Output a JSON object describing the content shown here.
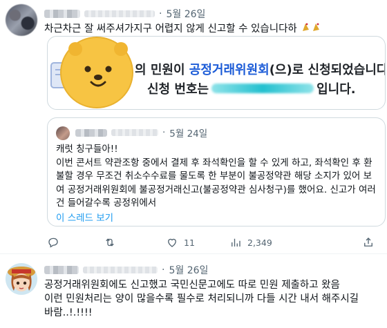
{
  "post1": {
    "dot": "·",
    "date": "5월 26일",
    "text": "차근차근 잘 써주셔가지구 어렵지 않게 신고할 수 있습니다하",
    "emoji_icon": "party-popper-icon",
    "image_card": {
      "line1_prefix": "의 민원이 ",
      "line1_accent": "공정거래위원회",
      "line1_suffix": "(으)로 신청되었습니다.",
      "line2_prefix": "신청 번호는",
      "line2_suffix": "입니다."
    },
    "quote": {
      "dot": "·",
      "date": "5월 24일",
      "lines": [
        "캐럿 칭구들아!!",
        "이번 콘서트 약관조항 중에서 결제 후 좌석확인을 할 수 있게 하고, 좌석확인 후 환불할 경우 무조건 취소수수료를 물도록 한 부분이 불공정약관 해당 소지가 있어 보여 공정거래위원회에 불공정거래신고(불공정약관 심사청구)를 했어요. 신고가 여러 건 들어갈수록 공정위에서"
      ],
      "show_thread": "이 스레드 보기"
    },
    "actions": {
      "reply_count": "",
      "retweet_count": "",
      "like_count": "11",
      "views_count": "2,349"
    }
  },
  "post2": {
    "dot": "·",
    "date": "5월 26일",
    "lines": [
      "공정거래위원회에도 신고했고 국민신문고에도 따로 민원 제출하고 왔음",
      "이런 민원처리는 양이 많을수록 필수로 처리되니까 다들 시간 내서 해주시길",
      "바람..!.!!!!"
    ]
  },
  "colors": {
    "accent": "#1d9bf0",
    "card_accent": "#1b5bd7",
    "muted": "#536471",
    "border": "#cfd9de"
  }
}
